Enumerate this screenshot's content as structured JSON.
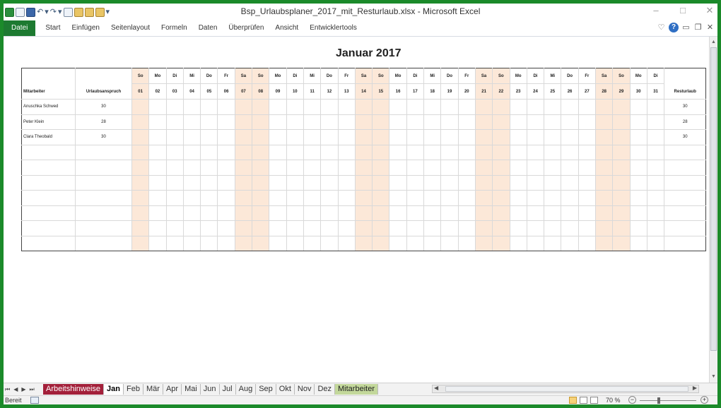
{
  "window": {
    "title": "Bsp_Urlaubsplaner_2017_mit_Resturlaub.xlsx  -  Microsoft Excel"
  },
  "ribbon": {
    "tabs": [
      "Datei",
      "Start",
      "Einfügen",
      "Seitenlayout",
      "Formeln",
      "Daten",
      "Überprüfen",
      "Ansicht",
      "Entwicklertools"
    ]
  },
  "sheet": {
    "title": "Januar 2017",
    "headers": {
      "employee": "Mitarbeiter",
      "entitlement": "Urlaubsanspruch",
      "remaining": "Resturlaub"
    },
    "days": [
      {
        "wd": "So",
        "n": "01",
        "we": true
      },
      {
        "wd": "Mo",
        "n": "02",
        "we": false
      },
      {
        "wd": "Di",
        "n": "03",
        "we": false
      },
      {
        "wd": "Mi",
        "n": "04",
        "we": false
      },
      {
        "wd": "Do",
        "n": "05",
        "we": false
      },
      {
        "wd": "Fr",
        "n": "06",
        "we": false
      },
      {
        "wd": "Sa",
        "n": "07",
        "we": true
      },
      {
        "wd": "So",
        "n": "08",
        "we": true
      },
      {
        "wd": "Mo",
        "n": "09",
        "we": false
      },
      {
        "wd": "Di",
        "n": "10",
        "we": false
      },
      {
        "wd": "Mi",
        "n": "11",
        "we": false
      },
      {
        "wd": "Do",
        "n": "12",
        "we": false
      },
      {
        "wd": "Fr",
        "n": "13",
        "we": false
      },
      {
        "wd": "Sa",
        "n": "14",
        "we": true
      },
      {
        "wd": "So",
        "n": "15",
        "we": true
      },
      {
        "wd": "Mo",
        "n": "16",
        "we": false
      },
      {
        "wd": "Di",
        "n": "17",
        "we": false
      },
      {
        "wd": "Mi",
        "n": "18",
        "we": false
      },
      {
        "wd": "Do",
        "n": "19",
        "we": false
      },
      {
        "wd": "Fr",
        "n": "20",
        "we": false
      },
      {
        "wd": "Sa",
        "n": "21",
        "we": true
      },
      {
        "wd": "So",
        "n": "22",
        "we": true
      },
      {
        "wd": "Mo",
        "n": "23",
        "we": false
      },
      {
        "wd": "Di",
        "n": "24",
        "we": false
      },
      {
        "wd": "Mi",
        "n": "25",
        "we": false
      },
      {
        "wd": "Do",
        "n": "26",
        "we": false
      },
      {
        "wd": "Fr",
        "n": "27",
        "we": false
      },
      {
        "wd": "Sa",
        "n": "28",
        "we": true
      },
      {
        "wd": "So",
        "n": "29",
        "we": true
      },
      {
        "wd": "Mo",
        "n": "30",
        "we": false
      },
      {
        "wd": "Di",
        "n": "31",
        "we": false
      }
    ],
    "employees": [
      {
        "name": "Anuschka Schwed",
        "entitlement": "30",
        "remaining": "30"
      },
      {
        "name": "Peter Klein",
        "entitlement": "28",
        "remaining": "28"
      },
      {
        "name": "Clara Theobald",
        "entitlement": "30",
        "remaining": "30"
      },
      {
        "name": "",
        "entitlement": "",
        "remaining": ""
      },
      {
        "name": "",
        "entitlement": "",
        "remaining": ""
      },
      {
        "name": "",
        "entitlement": "",
        "remaining": ""
      },
      {
        "name": "",
        "entitlement": "",
        "remaining": ""
      },
      {
        "name": "",
        "entitlement": "",
        "remaining": ""
      },
      {
        "name": "",
        "entitlement": "",
        "remaining": ""
      },
      {
        "name": "",
        "entitlement": "",
        "remaining": ""
      }
    ]
  },
  "sheet_tabs": [
    {
      "label": "Arbeitshinweise",
      "style": "red"
    },
    {
      "label": "Jan",
      "style": "active"
    },
    {
      "label": "Feb",
      "style": ""
    },
    {
      "label": "Mär",
      "style": ""
    },
    {
      "label": "Apr",
      "style": ""
    },
    {
      "label": "Mai",
      "style": ""
    },
    {
      "label": "Jun",
      "style": ""
    },
    {
      "label": "Jul",
      "style": ""
    },
    {
      "label": "Aug",
      "style": ""
    },
    {
      "label": "Sep",
      "style": ""
    },
    {
      "label": "Okt",
      "style": ""
    },
    {
      "label": "Nov",
      "style": ""
    },
    {
      "label": "Dez",
      "style": ""
    },
    {
      "label": "Mitarbeiter",
      "style": "green"
    }
  ],
  "status": {
    "text": "Bereit",
    "zoom": "70 %"
  },
  "colors": {
    "weekend": "#fce8d8",
    "file_tab": "#1d7a31",
    "frame": "#1b8a2a"
  }
}
